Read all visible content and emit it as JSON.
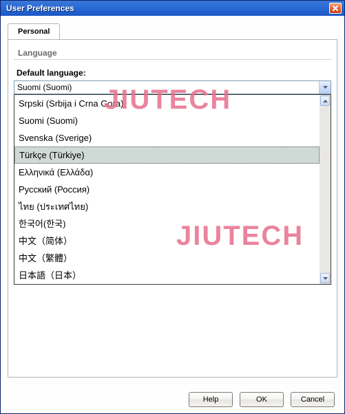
{
  "window": {
    "title": "User Preferences"
  },
  "tabs": {
    "personal": "Personal"
  },
  "section": {
    "title": "Language",
    "field_label": "Default language:",
    "selected": "Suomi (Suomi)"
  },
  "dropdown_options": [
    {
      "label": "Srpski (Srbija i Crna Gora)",
      "highlighted": false
    },
    {
      "label": "Suomi (Suomi)",
      "highlighted": false
    },
    {
      "label": "Svenska (Sverige)",
      "highlighted": false
    },
    {
      "label": "Türkçe (Türkiye)",
      "highlighted": true
    },
    {
      "label": "Ελληνικά (Ελλάδα)",
      "highlighted": false
    },
    {
      "label": "Русский (Россия)",
      "highlighted": false
    },
    {
      "label": "ไทย (ประเทศไทย)",
      "highlighted": false
    },
    {
      "label": "한국어(한국)",
      "highlighted": false
    },
    {
      "label": "中文（简体）",
      "highlighted": false
    },
    {
      "label": "中文（繁體）",
      "highlighted": false
    },
    {
      "label": "日本語（日本）",
      "highlighted": false
    }
  ],
  "buttons": {
    "help": "Help",
    "ok": "OK",
    "cancel": "Cancel"
  },
  "watermark": {
    "text1": "JIUTECH",
    "text2": "JIUTECH"
  },
  "colors": {
    "titlebar_bg": "#296bd6",
    "close_bg": "#e4673d",
    "border": "#b5b5b5",
    "combo_border": "#7e9db9",
    "highlight_bg": "#cfd9d5",
    "watermark": "#e76f8d"
  }
}
